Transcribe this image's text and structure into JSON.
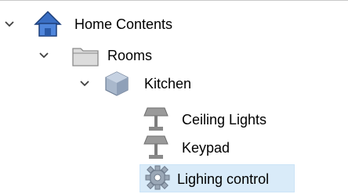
{
  "tree": {
    "items": [
      {
        "label": "Home Contents",
        "icon": "home-icon",
        "expanded": true
      },
      {
        "label": "Rooms",
        "icon": "folder-icon",
        "expanded": true
      },
      {
        "label": "Kitchen",
        "icon": "cube-icon",
        "expanded": true
      },
      {
        "label": "Ceiling Lights",
        "icon": "lamp-icon"
      },
      {
        "label": "Keypad",
        "icon": "lamp-icon"
      },
      {
        "label": "Lighing control",
        "icon": "gear-icon",
        "selected": true
      }
    ]
  },
  "colors": {
    "selection": "#d9ebf9",
    "home_roof": "#3a6fc4",
    "folder": "#c9c9c9",
    "lamp": "#8a8a8a"
  }
}
